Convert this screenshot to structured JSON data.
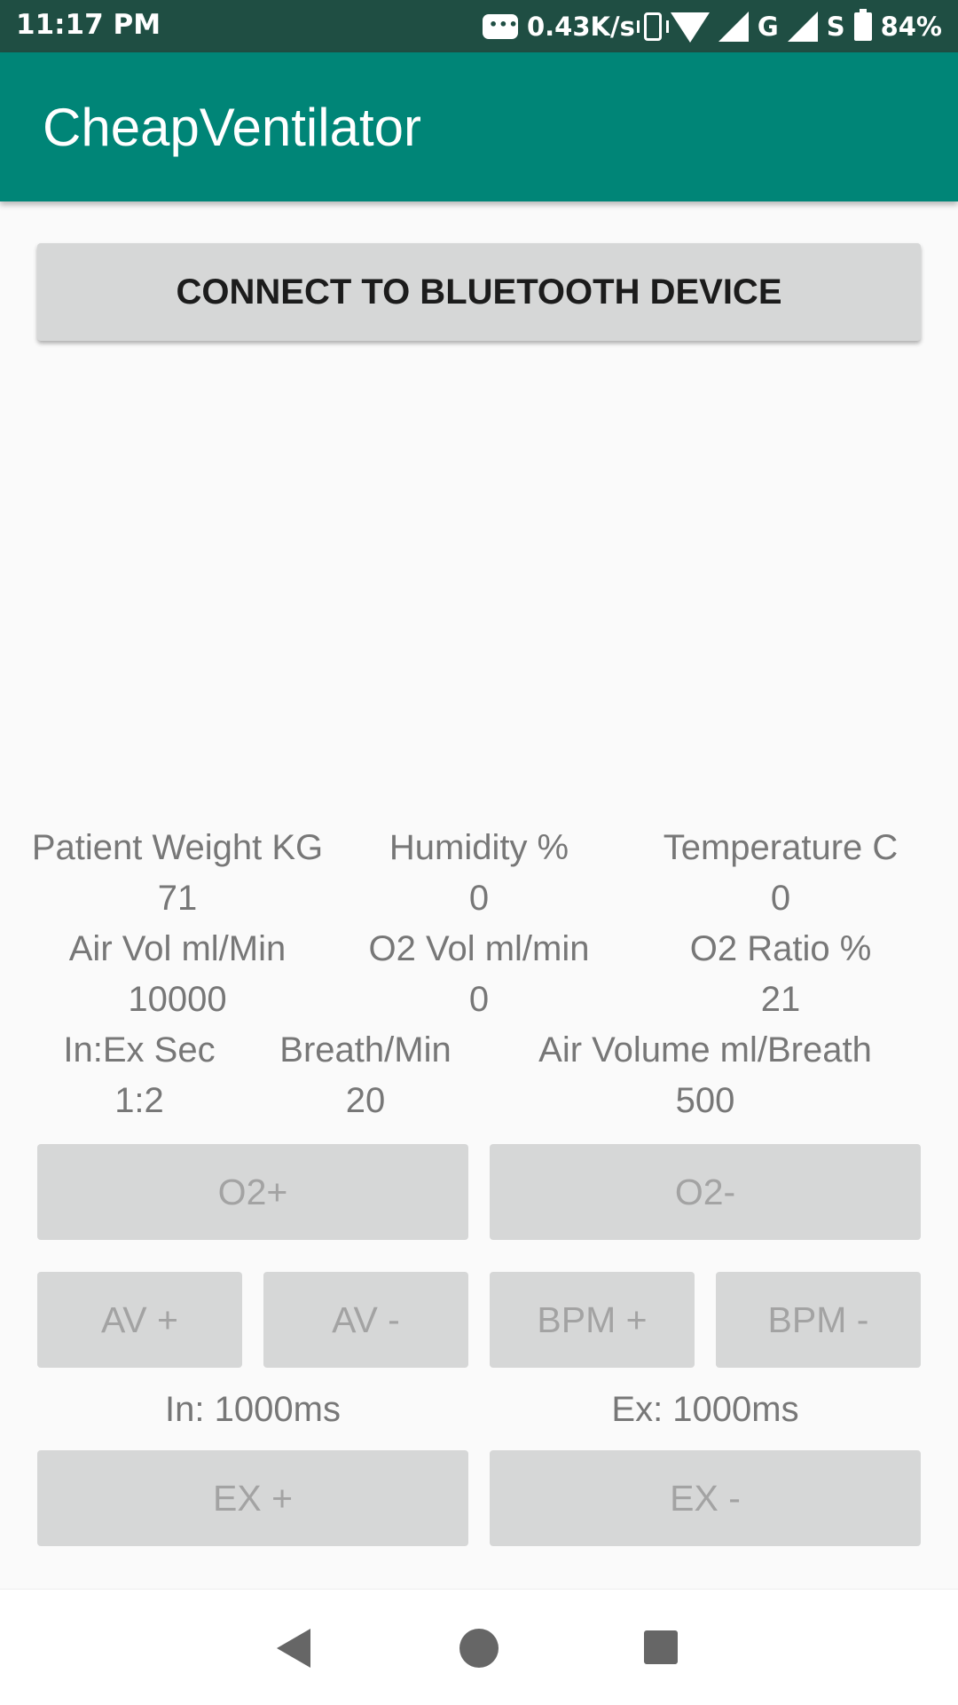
{
  "status_bar": {
    "time": "11:17 PM",
    "net_speed": "0.43K/s",
    "network_g": "G",
    "network_s": "S",
    "battery": "84%"
  },
  "app_bar": {
    "title": "CheapVentilator"
  },
  "connect_button": "CONNECT TO BLUETOOTH DEVICE",
  "metrics": {
    "patient_weight": {
      "label": "Patient Weight KG",
      "value": "71"
    },
    "humidity": {
      "label": "Humidity %",
      "value": "0"
    },
    "temperature": {
      "label": "Temperature C",
      "value": "0"
    },
    "air_vol": {
      "label": "Air Vol ml/Min",
      "value": "10000"
    },
    "o2_vol": {
      "label": "O2 Vol ml/min",
      "value": "0"
    },
    "o2_ratio": {
      "label": "O2 Ratio %",
      "value": "21"
    },
    "in_ex": {
      "label": "In:Ex Sec",
      "value": "1:2"
    },
    "breath_min": {
      "label": "Breath/Min",
      "value": "20"
    },
    "air_volume_breath": {
      "label": "Air Volume ml/Breath",
      "value": "500"
    }
  },
  "controls": {
    "o2_plus": "O2+",
    "o2_minus": "O2-",
    "av_plus": "AV +",
    "av_minus": "AV -",
    "bpm_plus": "BPM +",
    "bpm_minus": "BPM -",
    "in_time": "In: 1000ms",
    "ex_time": "Ex: 1000ms",
    "ex_plus": "EX +",
    "ex_minus": "EX -"
  },
  "icons": {
    "message": "message-icon",
    "vibrate": "vibrate-icon",
    "wifi": "wifi-icon",
    "signal": "signal-icon",
    "battery": "battery-icon",
    "back": "back-icon",
    "home": "home-icon",
    "recents": "recents-icon"
  },
  "colors": {
    "app_bar": "#008577",
    "status_bar": "#1f4e43",
    "button_bg": "#d6d7d7",
    "disabled_text": "#a3a3a3"
  }
}
